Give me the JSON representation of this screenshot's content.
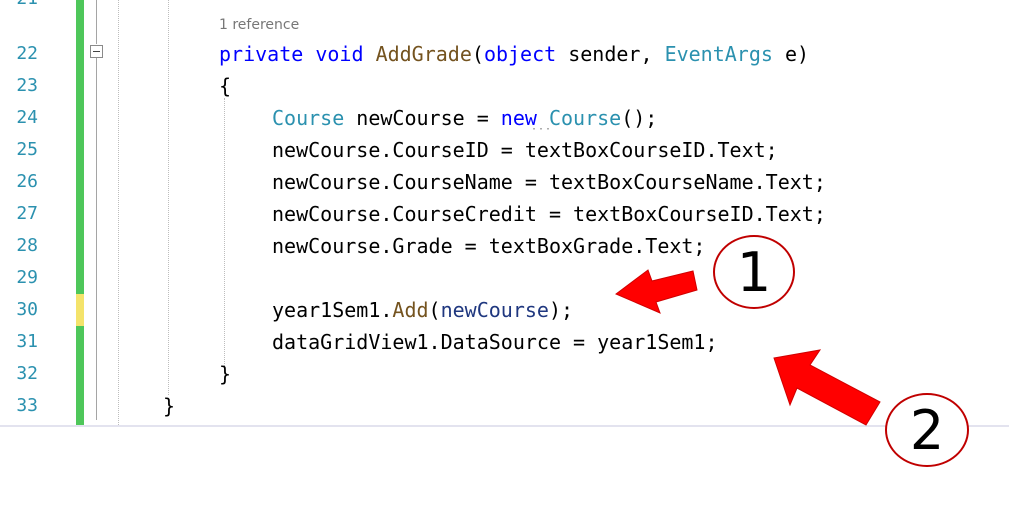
{
  "editor": {
    "line_numbers": [
      "21",
      "22",
      "23",
      "24",
      "25",
      "26",
      "27",
      "28",
      "29",
      "30",
      "31",
      "32",
      "33"
    ],
    "codelens": "1 reference",
    "code": {
      "l22": {
        "kw1": "private",
        "kw2": "void",
        "method": "AddGrade",
        "p1": "(",
        "t1": "object",
        "p2": " sender, ",
        "t2": "EventArgs",
        "p3": " e)"
      },
      "l23": {
        "brace": "{"
      },
      "l24": {
        "t1": "Course",
        "p1": " newCourse = ",
        "kw": "new",
        "p2": " ",
        "t2": "Course",
        "p3": "();"
      },
      "l25": {
        "text": "newCourse.CourseID = textBoxCourseID.Text;"
      },
      "l26": {
        "text": "newCourse.CourseName = textBoxCourseName.Text;"
      },
      "l27": {
        "text": "newCourse.CourseCredit = textBoxCourseID.Text;"
      },
      "l28": {
        "text": "newCourse.Grade = textBoxGrade.Text;"
      },
      "l30": {
        "p1": "year1Sem1.",
        "method": "Add",
        "p2": "(",
        "param": "newCourse",
        "p3": ");"
      },
      "l31": {
        "text": "dataGridView1.DataSource = year1Sem1;"
      },
      "l32": {
        "brace": "}"
      },
      "l33": {
        "brace": "}"
      }
    }
  },
  "annotations": {
    "callout1": "1",
    "callout2": "2",
    "arrow_color": "#ff0000"
  }
}
